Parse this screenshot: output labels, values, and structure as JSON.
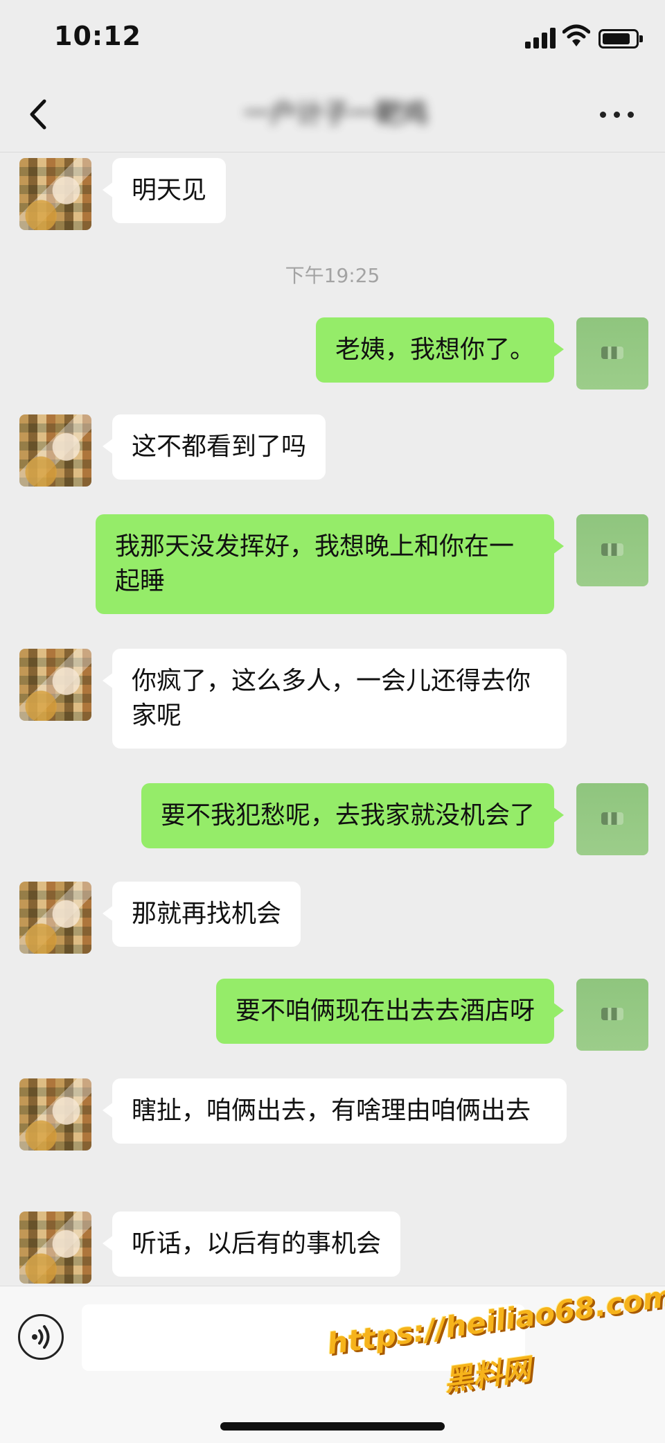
{
  "status_bar": {
    "time": "10:12",
    "battery_level": 0.85
  },
  "nav": {
    "title": "一户计子一靶鸡",
    "back_icon": "chevron-left-icon",
    "more_icon": "ellipsis-icon"
  },
  "messages": [
    {
      "from": "contact",
      "text": "明天见"
    },
    {
      "type": "timestamp",
      "text": "下午19:25"
    },
    {
      "from": "me",
      "text": "老姨，我想你了。"
    },
    {
      "from": "contact",
      "text": "这不都看到了吗"
    },
    {
      "from": "me",
      "text": "我那天没发挥好，我想晚上和你在一起睡"
    },
    {
      "from": "contact",
      "text": "你疯了，这么多人，一会儿还得去你家呢"
    },
    {
      "from": "me",
      "text": "要不我犯愁呢，去我家就没机会了"
    },
    {
      "from": "contact",
      "text": "那就再找机会"
    },
    {
      "from": "me",
      "text": "要不咱俩现在出去去酒店呀"
    },
    {
      "from": "contact",
      "text": "瞎扯，咱俩出去，有啥理由咱俩出去"
    },
    {
      "from": "contact",
      "text": "听话，以后有的事机会"
    }
  ],
  "input_bar": {
    "voice_icon": "voice-icon",
    "input_value": ""
  },
  "watermark": {
    "url": "https://heiliao68.com",
    "name": "黑料网"
  },
  "colors": {
    "background": "#ededed",
    "outgoing_bubble": "#95ec69",
    "incoming_bubble": "#ffffff",
    "watermark": "#f6b31b"
  }
}
